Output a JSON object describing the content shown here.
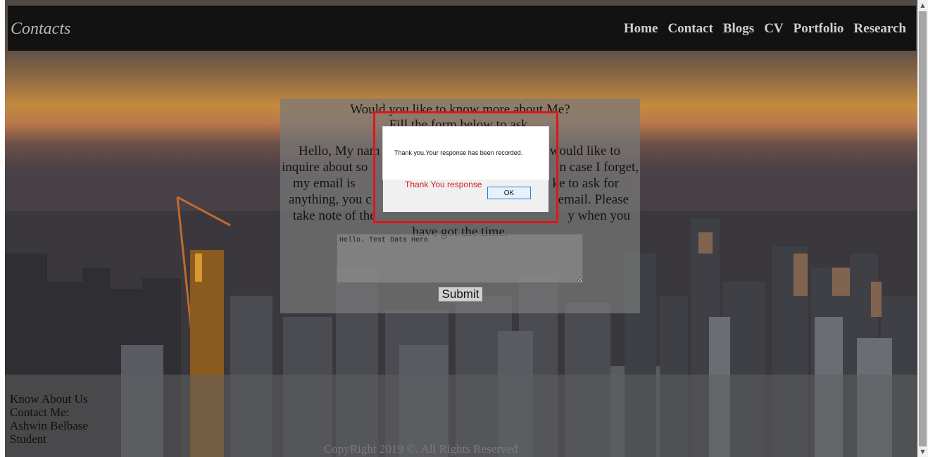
{
  "header": {
    "site_title": "Contacts",
    "nav": [
      "Home",
      "Contact",
      "Blogs",
      "CV",
      "Portfolio",
      "Research"
    ]
  },
  "form": {
    "heading": "Would you like to know more about Me?",
    "subheading": "Fill the form below to ask.",
    "intro_fragments": {
      "line1_left": "Hello, My nam",
      "line1_right": "would like to",
      "line2_left": "inquire about so",
      "line2_right": "in case I forget,",
      "line3_left": "my email is",
      "line3_right": "ke to ask for",
      "line4_left": "anything, you c",
      "line4_right": "email. Please",
      "line5_left": "take note of the",
      "line5_right": "y when you",
      "line6": "have got the time."
    },
    "message_value": "Hello. Test Data Here",
    "submit_label": "Submit"
  },
  "alert": {
    "message": "Thank you.Your response has been recorded.",
    "status": "Thank You response",
    "ok_label": "OK",
    "highlight_color": "#e0161b"
  },
  "footer": {
    "links": [
      "Know About Us",
      "Contact Me:",
      "Ashwin Belbase",
      "Student"
    ],
    "copyright": "CopyRight 2019 ©. All Rights Reserved"
  },
  "scrollbar": {
    "up_icon": "▲",
    "down_icon": "▼"
  }
}
